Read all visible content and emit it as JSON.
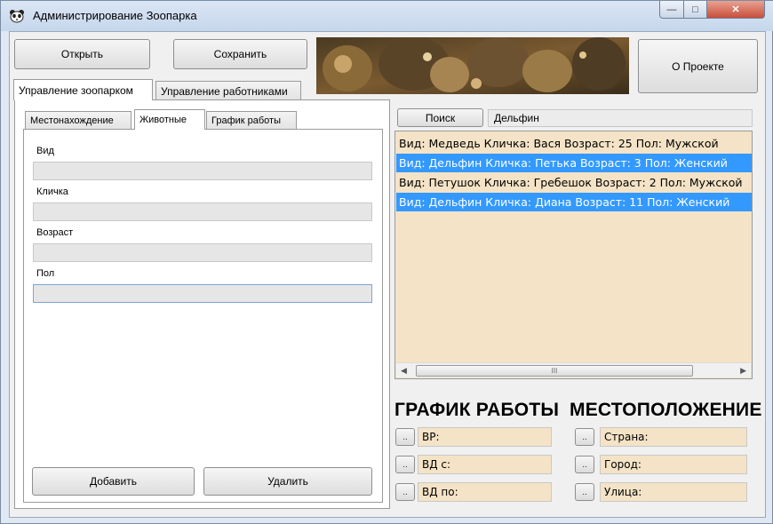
{
  "window": {
    "title": "Администрирование Зоопарка",
    "controls": {
      "minimize": "—",
      "maximize": "□",
      "close": "✕"
    }
  },
  "toolbar": {
    "open_label": "Открыть",
    "save_label": "Сохранить",
    "about_label": "О Проекте"
  },
  "main_tabs": [
    {
      "label": "Управление зоопарком",
      "active": true
    },
    {
      "label": "Управление работниками",
      "active": false
    }
  ],
  "sub_tabs": [
    {
      "label": "Местонахождение",
      "active": false
    },
    {
      "label": "Животные",
      "active": true
    },
    {
      "label": "График работы",
      "active": false
    }
  ],
  "animal_form": {
    "fields": [
      {
        "label": "Вид",
        "value": ""
      },
      {
        "label": "Кличка",
        "value": ""
      },
      {
        "label": "Возраст",
        "value": ""
      },
      {
        "label": "Пол",
        "value": ""
      }
    ],
    "add_label": "Добавить",
    "delete_label": "Удалить"
  },
  "search": {
    "button_label": "Поиск",
    "value": "Дельфин"
  },
  "animal_list": {
    "items": [
      {
        "text": "Вид: Медведь Кличка: Вася Возраст: 25 Пол: Мужской",
        "selected": false
      },
      {
        "text": "Вид: Дельфин Кличка: Петька Возраст: 3 Пол: Женский",
        "selected": true
      },
      {
        "text": "Вид: Петушок Кличка: Гребешок Возраст: 2 Пол: Мужской",
        "selected": false
      },
      {
        "text": "Вид: Дельфин Кличка: Диана Возраст: 11 Пол: Женский",
        "selected": true
      }
    ],
    "scroll_thumb_grip": "III"
  },
  "schedule": {
    "title": "ГРАФИК РАБОТЫ",
    "rows": [
      {
        "button": "..",
        "label": "ВР:"
      },
      {
        "button": "..",
        "label": "ВД с:"
      },
      {
        "button": "..",
        "label": "ВД по:"
      }
    ]
  },
  "location": {
    "title": "МЕСТОПОЛОЖЕНИЕ",
    "rows": [
      {
        "button": "..",
        "label": "Страна:"
      },
      {
        "button": "..",
        "label": "Город:"
      },
      {
        "button": "..",
        "label": "Улица:"
      }
    ]
  },
  "colors": {
    "selection": "#3399ff",
    "list_background": "#f4e3c6",
    "window_frame": "#dfe8f3"
  }
}
